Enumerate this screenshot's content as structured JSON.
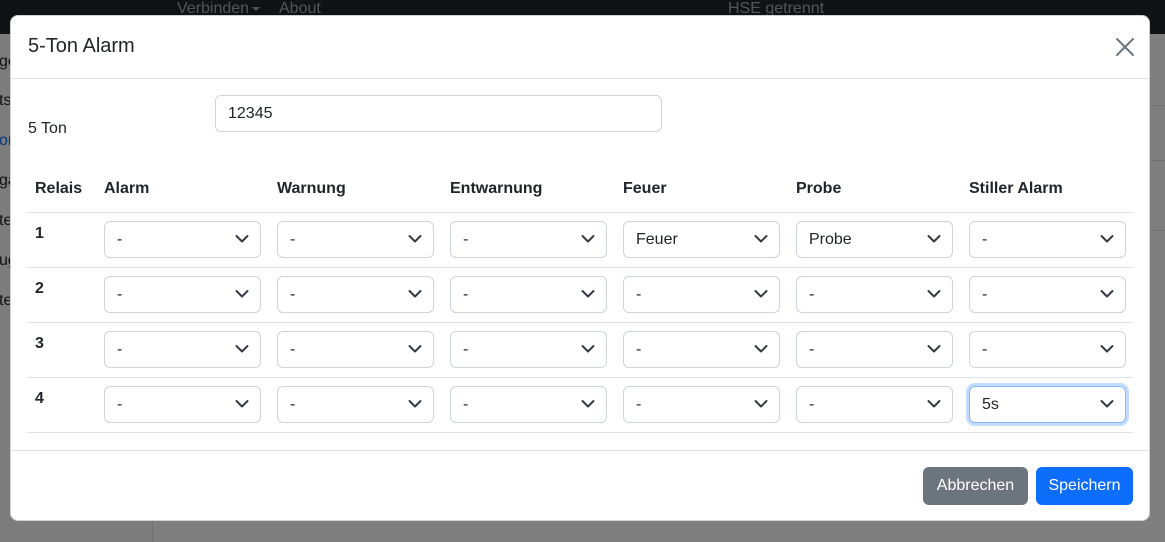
{
  "background": {
    "navbar": {
      "connect_label": "Verbinden",
      "about_label": "About",
      "status_text": "HSE getrennt"
    },
    "sidebar_fragments": [
      "ge",
      "ts",
      "or",
      "ga",
      "te",
      "ug",
      "te"
    ]
  },
  "modal": {
    "title": "5-Ton Alarm",
    "close_icon": "close-icon",
    "ton_label": "5 Ton",
    "ton_value": "12345",
    "table": {
      "headers": [
        "Relais",
        "Alarm",
        "Warnung",
        "Entwarnung",
        "Feuer",
        "Probe",
        "Stiller Alarm"
      ],
      "rows": [
        {
          "relais": "1",
          "values": [
            "-",
            "-",
            "-",
            "Feuer",
            "Probe",
            "-"
          ]
        },
        {
          "relais": "2",
          "values": [
            "-",
            "-",
            "-",
            "-",
            "-",
            "-"
          ]
        },
        {
          "relais": "3",
          "values": [
            "-",
            "-",
            "-",
            "-",
            "-",
            "-"
          ]
        },
        {
          "relais": "4",
          "values": [
            "-",
            "-",
            "-",
            "-",
            "-",
            "5s"
          ]
        }
      ]
    },
    "footer": {
      "cancel_label": "Abbrechen",
      "save_label": "Speichern"
    }
  },
  "colors": {
    "primary": "#0d6efd",
    "secondary": "#6c757d",
    "navbar": "#212529",
    "focus_border": "#86b7fe"
  }
}
